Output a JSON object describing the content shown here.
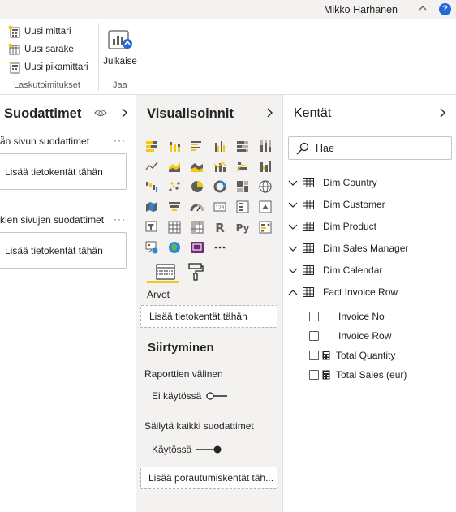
{
  "topbar": {
    "user_name": "Mikko Harhanen",
    "help_label": "?"
  },
  "ribbon": {
    "calc_items": [
      {
        "label": "Uusi mittari",
        "icon": "new-measure-icon"
      },
      {
        "label": "Uusi sarake",
        "icon": "new-column-icon"
      },
      {
        "label": "Uusi pikamittari",
        "icon": "quick-measure-icon"
      }
    ],
    "calc_group_label": "Laskutoimitukset",
    "publish_label": "Julkaise",
    "share_group_label": "Jaa"
  },
  "filters": {
    "title": "Suodattimet",
    "page_filters_label": "ä̈n sivun suodattimet",
    "page_drop": "Lisää tietokentät tähän",
    "all_pages_label": "kien sivujen suodattimet",
    "all_drop": "Lisää tietokentät tähän",
    "more": "···"
  },
  "visualizations": {
    "title": "Visualisoinnit",
    "icons": [
      "stacked-bar-icon",
      "stacked-column-icon",
      "clustered-bar-icon",
      "clustered-column-icon",
      "100-bar-icon",
      "100-column-icon",
      "line-chart-icon",
      "area-chart-icon",
      "stacked-area-icon",
      "line-column-icon",
      "line-clustered-icon",
      "ribbon-chart-icon",
      "waterfall-icon",
      "scatter-icon",
      "pie-icon",
      "donut-icon",
      "treemap-icon",
      "map-icon",
      "filled-map-icon",
      "funnel-icon",
      "gauge-icon",
      "card-icon",
      "multirow-card-icon",
      "kpi-icon",
      "slicer-icon",
      "table-icon",
      "matrix-icon",
      "r-visual-icon",
      "python-visual-icon",
      "key-influencers-icon",
      "decomposition-tree-icon",
      "arcgis-icon",
      "power-apps-icon",
      "more-visuals-icon"
    ],
    "more_label": "···",
    "values_label": "Arvot",
    "values_drop": "Lisää tietokentät tähän",
    "drill_head": "Siirtyminen",
    "cross_report_label": "Raporttien välinen",
    "cross_report_state": "Ei käytössä",
    "keep_filters_label": "Säilytä kaikki suodattimet",
    "keep_filters_state": "Käytössä",
    "drill_drop": "Lisää porautumiskentät täh..."
  },
  "fields": {
    "title": "Kentät",
    "search_placeholder": "Hae",
    "tables": [
      {
        "name": "Dim Country",
        "expanded": false
      },
      {
        "name": "Dim Customer",
        "expanded": false
      },
      {
        "name": "Dim Product",
        "expanded": false
      },
      {
        "name": "Dim Sales Manager",
        "expanded": false
      },
      {
        "name": "Dim Calendar",
        "expanded": false
      },
      {
        "name": "Fact Invoice Row",
        "expanded": true
      }
    ],
    "fact_fields": [
      {
        "name": "Invoice No",
        "measure": false
      },
      {
        "name": "Invoice Row",
        "measure": false
      },
      {
        "name": "Total Quantity",
        "measure": true
      },
      {
        "name": "Total Sales (eur)",
        "measure": true
      }
    ]
  },
  "colors": {
    "accent_yellow": "#f2c811",
    "help_blue": "#1f6ad8",
    "pane_gray": "#f3f2f1"
  }
}
